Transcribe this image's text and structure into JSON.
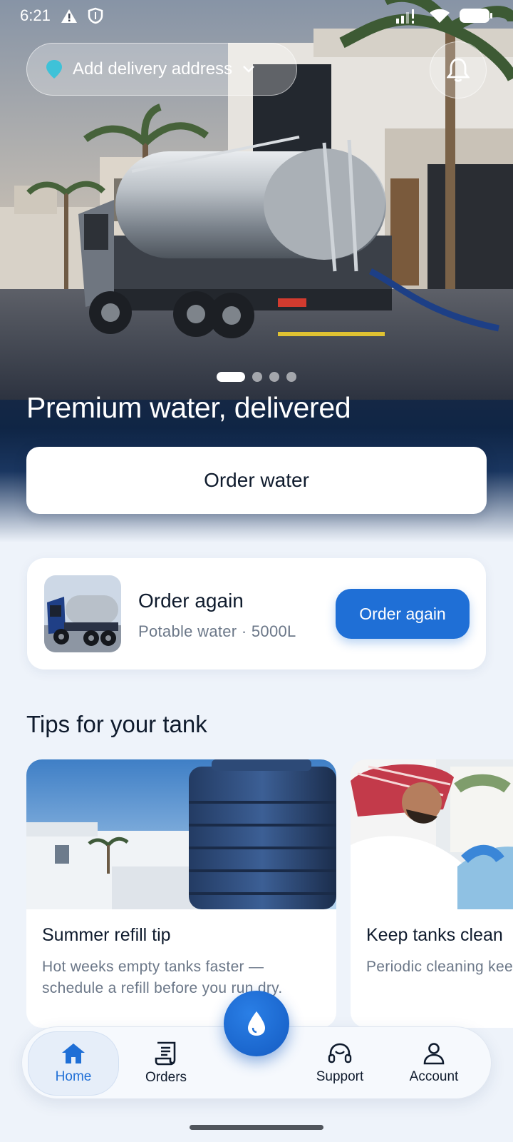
{
  "status_bar": {
    "time": "6:21"
  },
  "header": {
    "address_label": "Add delivery address",
    "carousel": {
      "total": 4,
      "active_index": 0
    }
  },
  "hero": {
    "title": "Premium water, delivered",
    "cta_label": "Order water"
  },
  "reorder": {
    "title": "Order again",
    "subtitle": "Potable water · 5000L",
    "button_label": "Order again"
  },
  "tips": {
    "heading": "Tips for your tank",
    "cards": [
      {
        "title": "Summer refill tip",
        "text": "Hot weeks empty tanks faster — schedule a refill before you run dry."
      },
      {
        "title": "Keep tanks clean",
        "text": "Periodic cleaning keeps water fresh and protects"
      }
    ]
  },
  "nav": {
    "items": [
      {
        "label": "Home",
        "icon": "home-icon",
        "active": true
      },
      {
        "label": "Orders",
        "icon": "receipt-icon",
        "active": false
      },
      {
        "label": "Support",
        "icon": "headset-icon",
        "active": false
      },
      {
        "label": "Account",
        "icon": "person-icon",
        "active": false
      }
    ],
    "fab_icon": "water-drop-icon"
  },
  "colors": {
    "accent": "#1f6fd6",
    "hero_dark": "#0f2545",
    "background": "#eef3fa"
  }
}
